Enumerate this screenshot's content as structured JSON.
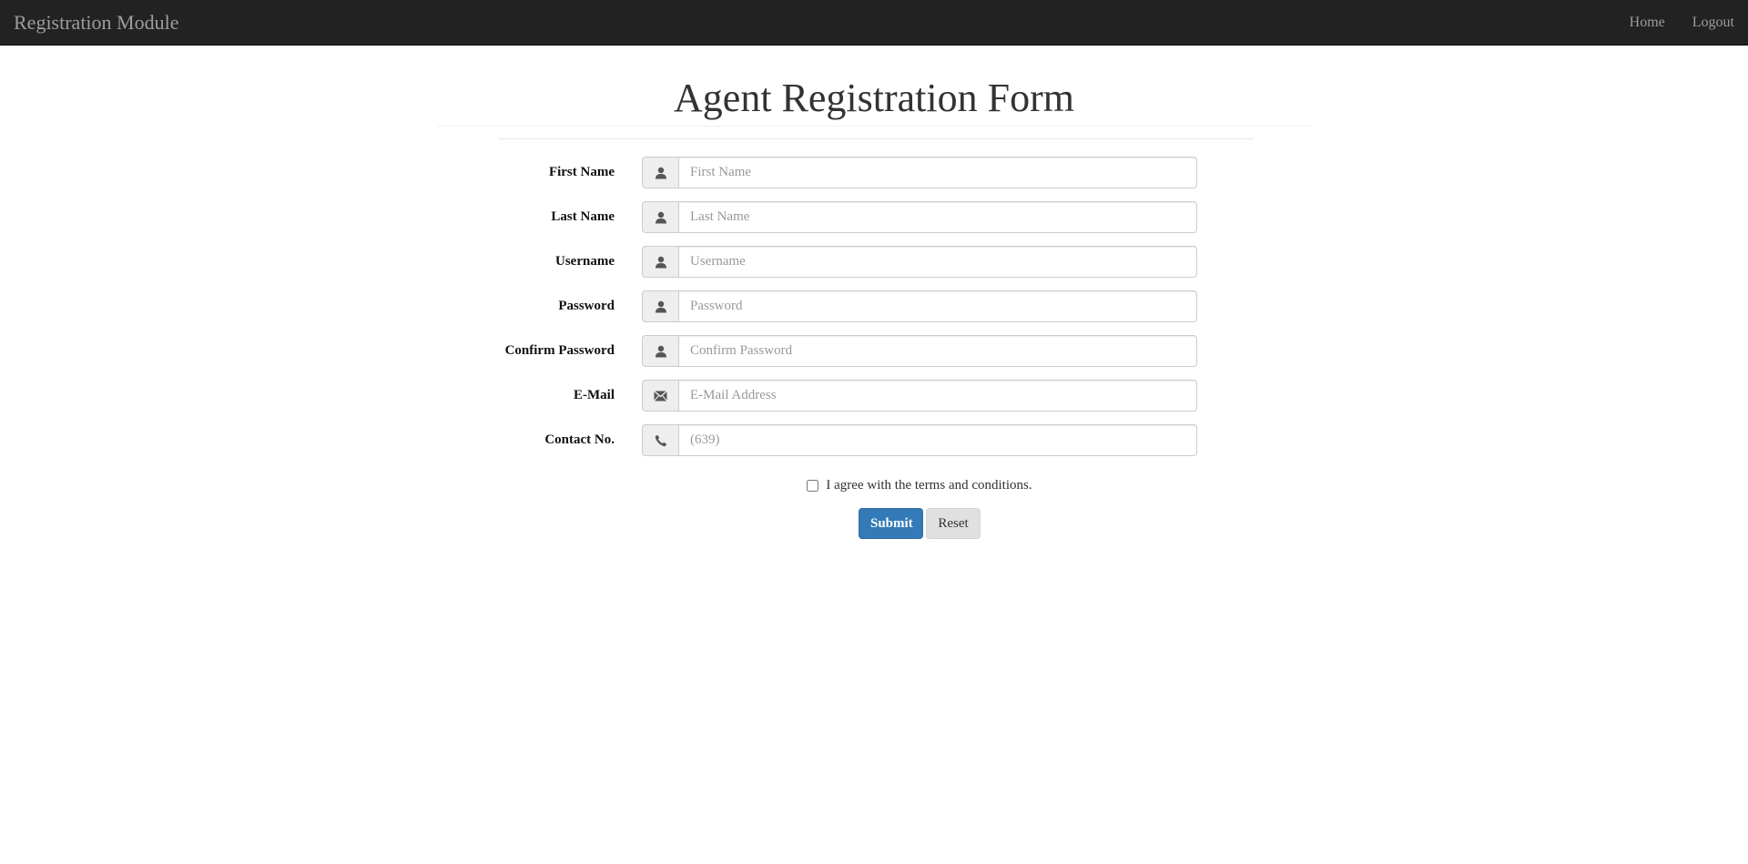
{
  "navbar": {
    "brand": "Registration Module",
    "links": [
      {
        "label": "Home"
      },
      {
        "label": "Logout"
      }
    ]
  },
  "page": {
    "title": "Agent Registration Form"
  },
  "form": {
    "fields": [
      {
        "label": "First Name",
        "placeholder": "First Name",
        "value": "",
        "icon": "user-icon"
      },
      {
        "label": "Last Name",
        "placeholder": "Last Name",
        "value": "",
        "icon": "user-icon"
      },
      {
        "label": "Username",
        "placeholder": "Username",
        "value": "",
        "icon": "user-icon"
      },
      {
        "label": "Password",
        "placeholder": "Password",
        "value": "",
        "icon": "user-icon"
      },
      {
        "label": "Confirm Password",
        "placeholder": "Confirm Password",
        "value": "",
        "icon": "user-icon"
      },
      {
        "label": "E-Mail",
        "placeholder": "E-Mail Address",
        "value": "",
        "icon": "envelope-icon"
      },
      {
        "label": "Contact No.",
        "placeholder": "(639)",
        "value": "",
        "icon": "phone-icon"
      }
    ],
    "terms_label": "I agree with the terms and conditions.",
    "terms_checked": false,
    "submit_label": "Submit",
    "reset_label": "Reset"
  },
  "colors": {
    "navbar_bg": "#222222",
    "primary": "#337ab7"
  }
}
